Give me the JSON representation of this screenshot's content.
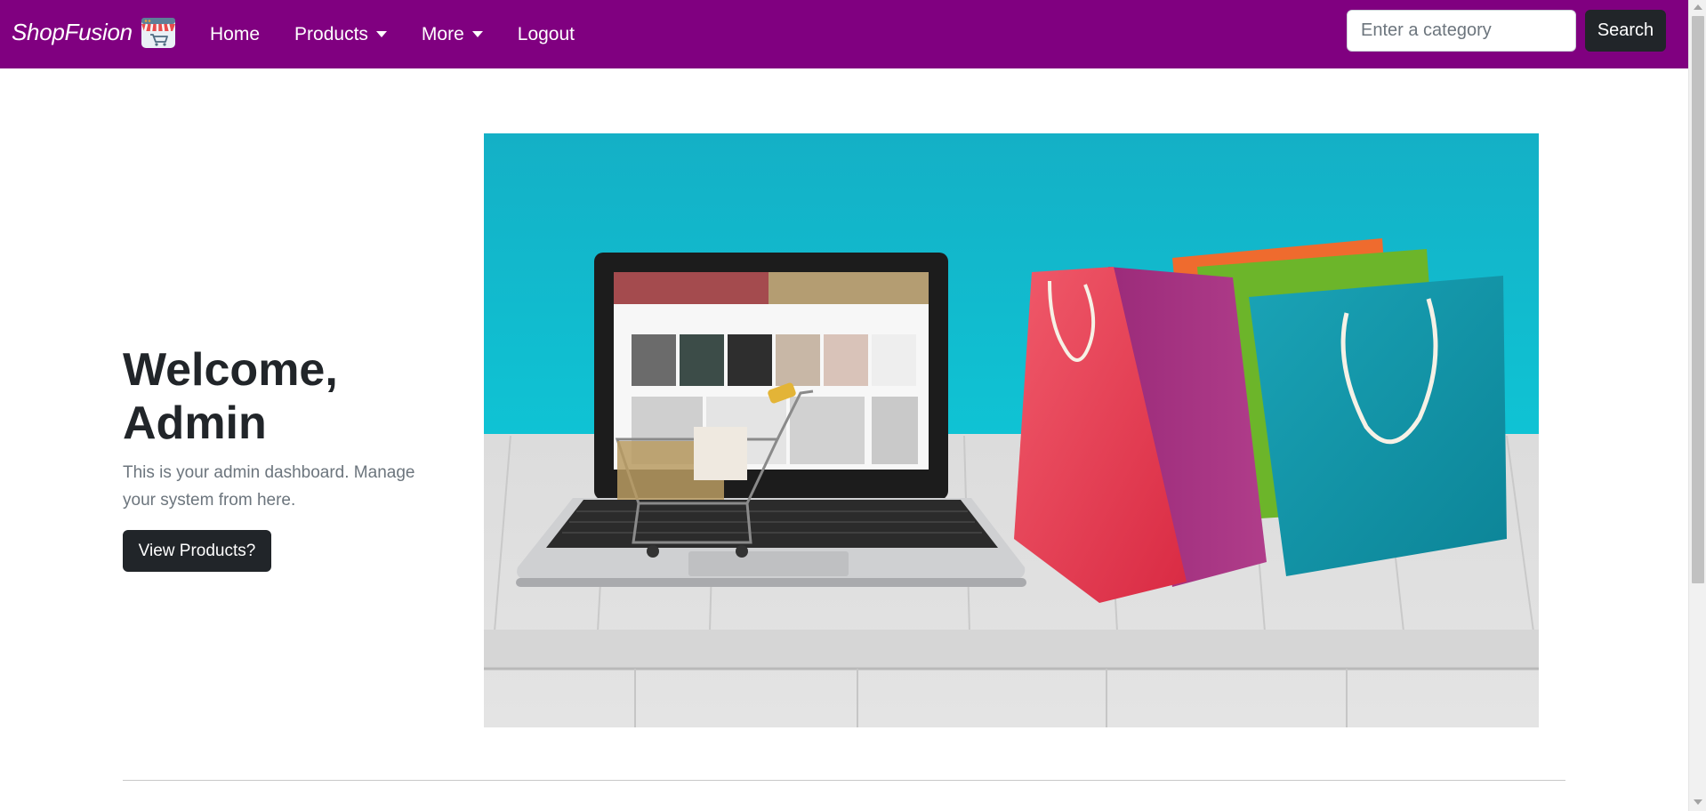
{
  "navbar": {
    "brand": "ShopFusion",
    "brand_icon": "shop-cart-storefront-icon",
    "links": [
      {
        "label": "Home",
        "dropdown": false
      },
      {
        "label": "Products",
        "dropdown": true
      },
      {
        "label": "More",
        "dropdown": true
      },
      {
        "label": "Logout",
        "dropdown": false
      }
    ],
    "search": {
      "placeholder": "Enter a category",
      "value": "",
      "button_label": "Search"
    },
    "background_color": "#800080"
  },
  "hero": {
    "title": "Welcome, Admin",
    "lead": "This is your admin dashboard. Manage your system from here.",
    "button_label": "View Products?",
    "image_icon": "laptop-shopping-cart-bags-image"
  },
  "colors": {
    "accent": "#800080",
    "dark": "#212529",
    "muted": "#6c757d",
    "image_teal": "#16b8cc"
  }
}
